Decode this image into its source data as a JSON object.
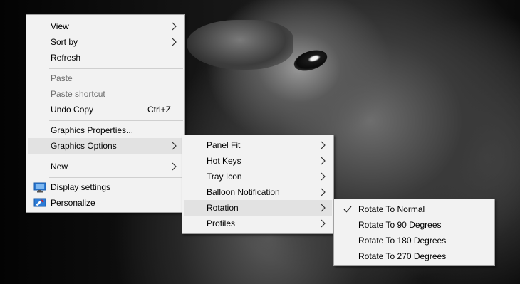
{
  "main_menu": {
    "items": [
      {
        "label": "View"
      },
      {
        "label": "Sort by"
      },
      {
        "label": "Refresh"
      },
      {
        "label": "Paste"
      },
      {
        "label": "Paste shortcut"
      },
      {
        "label": "Undo Copy",
        "shortcut": "Ctrl+Z"
      },
      {
        "label": "Graphics Properties..."
      },
      {
        "label": "Graphics Options"
      },
      {
        "label": "New"
      },
      {
        "label": "Display settings",
        "icon": "display-icon"
      },
      {
        "label": "Personalize",
        "icon": "personalize-icon"
      }
    ]
  },
  "graphics_options_menu": {
    "items": [
      {
        "label": "Panel Fit"
      },
      {
        "label": "Hot Keys"
      },
      {
        "label": "Tray Icon"
      },
      {
        "label": "Balloon Notification"
      },
      {
        "label": "Rotation"
      },
      {
        "label": "Profiles"
      }
    ]
  },
  "rotation_menu": {
    "items": [
      {
        "label": "Rotate To Normal",
        "checked": true
      },
      {
        "label": "Rotate To 90 Degrees"
      },
      {
        "label": "Rotate To 180 Degrees"
      },
      {
        "label": "Rotate To 270 Degrees"
      }
    ]
  },
  "colors": {
    "menu_background": "#f2f2f2",
    "hover_background": "#e2e2e2",
    "disabled_text": "#6d6d6d",
    "icon_blue": "#2b7bd6"
  }
}
